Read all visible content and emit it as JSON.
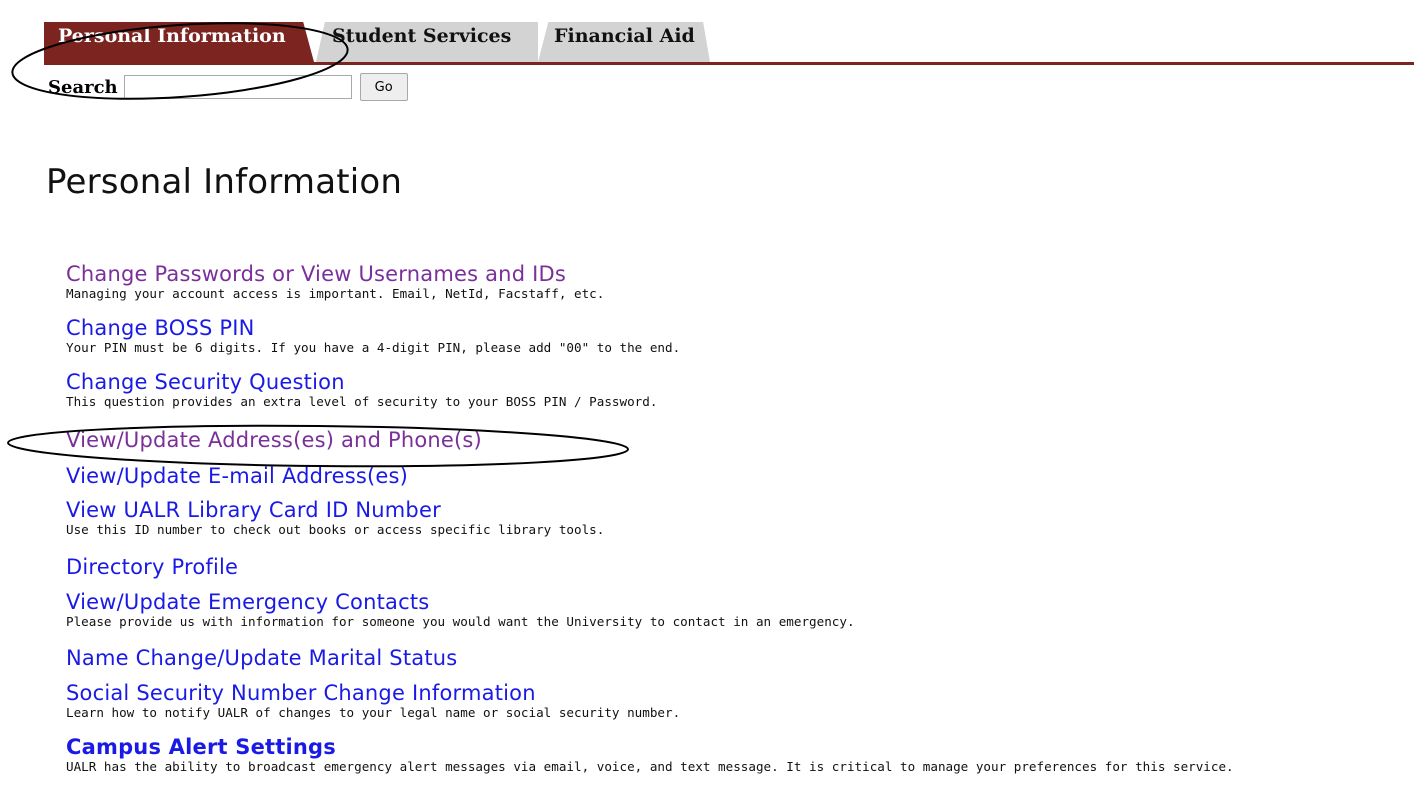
{
  "tabs": [
    {
      "label": "Personal Information",
      "active": true
    },
    {
      "label": "Student Services",
      "active": false
    },
    {
      "label": "Financial Aid",
      "active": false
    }
  ],
  "search": {
    "label": "Search",
    "value": "",
    "button_label": "Go"
  },
  "page_title": "Personal Information",
  "menu": [
    {
      "label": "Change Passwords or View Usernames and IDs",
      "description": "Managing your account access is important. Email, NetId, Facstaff, etc.",
      "visited": true
    },
    {
      "label": "Change BOSS PIN",
      "description": "Your PIN must be 6 digits. If you have a 4-digit PIN, please add \"00\" to the end.",
      "visited": false
    },
    {
      "label": "Change Security Question",
      "description": "This question provides an extra level of security to your BOSS PIN / Password.",
      "visited": false
    },
    {
      "label": "View/Update Address(es) and Phone(s)",
      "description": "",
      "visited": true
    },
    {
      "label": "View/Update E-mail Address(es)",
      "description": "",
      "visited": false
    },
    {
      "label": "View UALR Library Card ID Number",
      "description": "Use this ID number to check out books or access specific library tools.",
      "visited": false
    },
    {
      "label": "Directory Profile",
      "description": "",
      "visited": false
    },
    {
      "label": "View/Update Emergency Contacts",
      "description": "Please provide us with information for someone you would want the University to contact in an emergency.",
      "visited": false
    },
    {
      "label": "Name Change/Update Marital Status",
      "description": "",
      "visited": false
    },
    {
      "label": "Social Security Number Change Information",
      "description": "Learn how to notify UALR of changes to your legal name or social security number.",
      "visited": false
    },
    {
      "label": "Campus Alert Settings",
      "description": "UALR has the ability to broadcast emergency alert messages via email, voice, and text message. It is critical to manage your preferences for this service.",
      "visited": false
    }
  ],
  "colors": {
    "tab_active": "#7b2420",
    "tab_inactive": "#d3d3d3",
    "link": "#1a1ae6",
    "link_visited": "#7a2f9a"
  }
}
